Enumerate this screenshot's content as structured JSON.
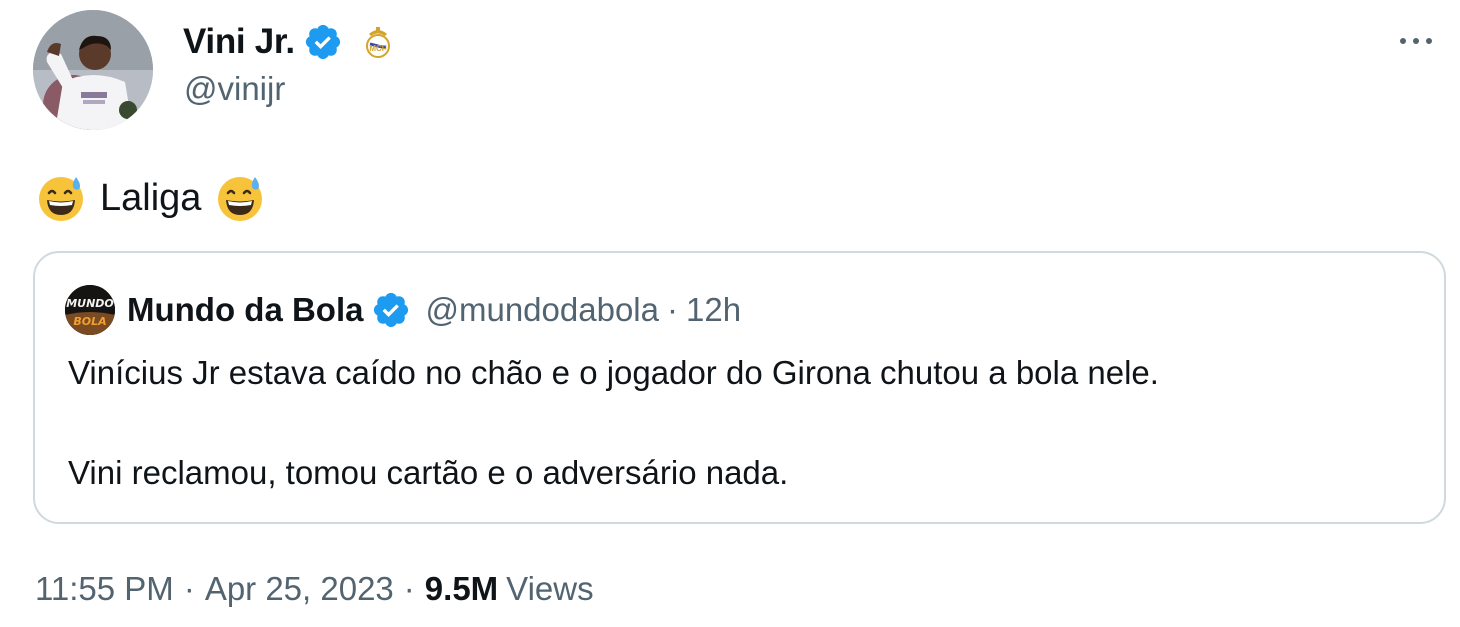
{
  "author": {
    "name": "Vini Jr.",
    "handle": "@vinijr",
    "verified": true,
    "club_badge": "real-madrid-crest"
  },
  "tweet": {
    "text": "Laliga",
    "leading_emoji": "grinning-face-with-sweat",
    "trailing_emoji": "grinning-face-with-sweat"
  },
  "quote": {
    "avatar_text": "MUNDO BOLA",
    "name": "Mundo da Bola",
    "handle": "@mundodabola",
    "separator": "·",
    "time": "12h",
    "paragraphs": [
      "Vinícius Jr estava caído no chão e o jogador do Girona chutou a bola nele.",
      "Vini reclamou, tomou cartão e o adversário nada."
    ]
  },
  "footer": {
    "time": "11:55 PM",
    "separator": "·",
    "date": "Apr 25, 2023",
    "views_count": "9.5M",
    "views_label": "Views"
  },
  "colors": {
    "text_primary": "#0f1419",
    "text_secondary": "#536471",
    "verified_blue": "#1d9bf0",
    "border": "#cfd9de"
  }
}
